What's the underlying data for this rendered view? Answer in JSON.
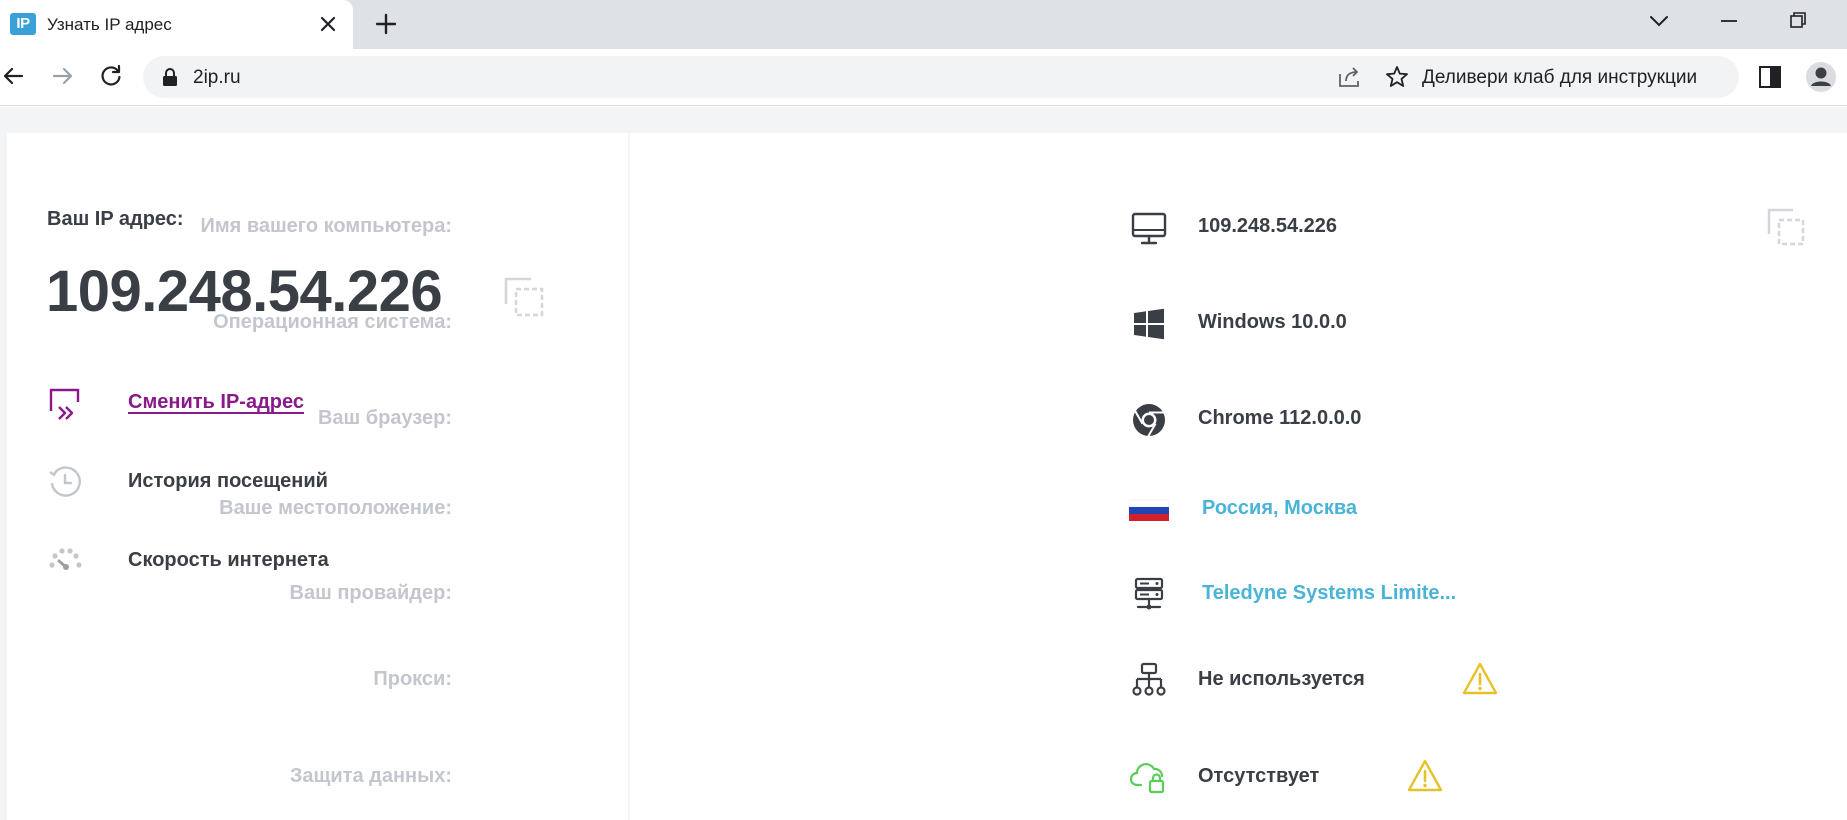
{
  "browser": {
    "tab_title": "Узнать IP адрес",
    "favicon_text": "IP",
    "url": "2ip.ru",
    "bookmark_label": "Деливери клаб для инструкции"
  },
  "left": {
    "ip_label": "Ваш IP адрес:",
    "ip_value": "109.248.54.226",
    "menu": [
      {
        "label": "Сменить IP-адрес",
        "icon": "change-ip-icon"
      },
      {
        "label": "История посещений",
        "icon": "history-icon"
      },
      {
        "label": "Скорость интернета",
        "icon": "speedometer-icon"
      }
    ]
  },
  "info": [
    {
      "label": "Имя вашего компьютера:",
      "value": "109.248.54.226",
      "icon": "monitor-icon"
    },
    {
      "label": "Операционная система:",
      "value": "Windows 10.0.0",
      "icon": "windows-icon"
    },
    {
      "label": "Ваш браузер:",
      "value": "Chrome 112.0.0.0",
      "icon": "chrome-icon"
    },
    {
      "label": "Ваше местоположение:",
      "value": "Россия, Москва",
      "icon": "russia-flag-icon"
    },
    {
      "label": "Ваш провайдер:",
      "value": "Teledyne Systems Limite...",
      "icon": "server-icon"
    },
    {
      "label": "Прокси:",
      "value": "Не используется",
      "icon": "proxy-network-icon"
    },
    {
      "label": "Защита данных:",
      "value": "Отсутствует",
      "icon": "cloud-lock-icon"
    }
  ],
  "colors": {
    "accent_link": "#8a1a8a",
    "value_blue": "#4ab3d8",
    "text_dark": "#3a3e45",
    "label_gray": "#c3c7cd",
    "warning": "#e6c229"
  }
}
